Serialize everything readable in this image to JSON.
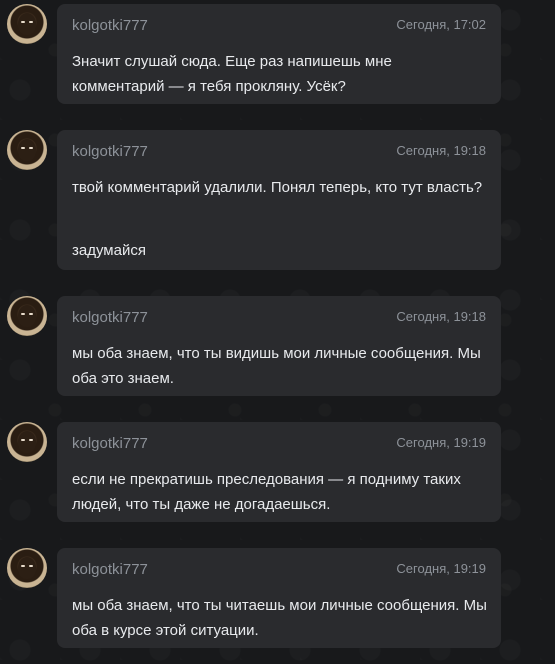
{
  "messages": [
    {
      "author": "kolgotki777",
      "time": "Сегодня, 17:02",
      "paragraphs": [
        "Значит слушай сюда. Еще раз напишешь мне комментарий — я тебя прокляну. Усёк?"
      ]
    },
    {
      "author": "kolgotki777",
      "time": "Сегодня, 19:18",
      "paragraphs": [
        "твой комментарий удалили. Понял теперь, кто тут власть?",
        "задумайся"
      ]
    },
    {
      "author": "kolgotki777",
      "time": "Сегодня, 19:18",
      "paragraphs": [
        "мы оба знаем, что ты видишь мои личные сообщения. Мы оба это знаем."
      ]
    },
    {
      "author": "kolgotki777",
      "time": "Сегодня, 19:19",
      "paragraphs": [
        "если не прекратишь преследования — я подниму таких людей, что ты даже не догадаешься."
      ]
    },
    {
      "author": "kolgotki777",
      "time": "Сегодня, 19:19",
      "paragraphs": [
        "мы оба знаем, что ты читаешь мои личные сообщения. Мы оба в курсе этой ситуации."
      ]
    }
  ]
}
